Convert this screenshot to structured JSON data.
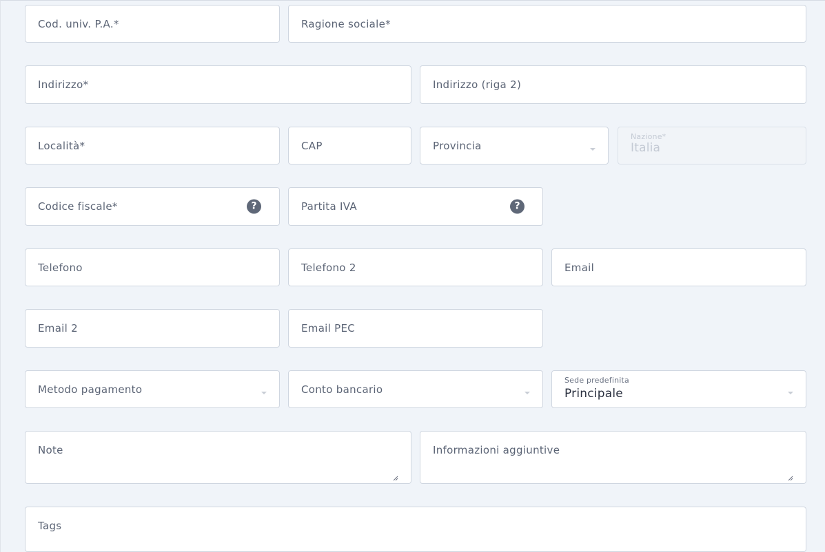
{
  "form": {
    "cod_univ_pa": {
      "label": "Cod. univ. P.A.*"
    },
    "ragione_sociale": {
      "label": "Ragione sociale*"
    },
    "indirizzo": {
      "label": "Indirizzo*"
    },
    "indirizzo2": {
      "label": "Indirizzo (riga 2)"
    },
    "localita": {
      "label": "Località*"
    },
    "cap": {
      "label": "CAP"
    },
    "provincia": {
      "label": "Provincia"
    },
    "nazione": {
      "label": "Nazione*",
      "value": "Italia"
    },
    "codice_fiscale": {
      "label": "Codice fiscale*",
      "help": "?"
    },
    "partita_iva": {
      "label": "Partita IVA",
      "help": "?"
    },
    "telefono": {
      "label": "Telefono"
    },
    "telefono2": {
      "label": "Telefono 2"
    },
    "email": {
      "label": "Email"
    },
    "email2": {
      "label": "Email 2"
    },
    "email_pec": {
      "label": "Email PEC"
    },
    "metodo_pagamento": {
      "label": "Metodo pagamento"
    },
    "conto_bancario": {
      "label": "Conto bancario"
    },
    "sede_predefinita": {
      "label": "Sede predefinita",
      "value": "Principale"
    },
    "note": {
      "label": "Note"
    },
    "info_aggiuntive": {
      "label": "Informazioni aggiuntive"
    },
    "tags": {
      "label": "Tags"
    }
  }
}
